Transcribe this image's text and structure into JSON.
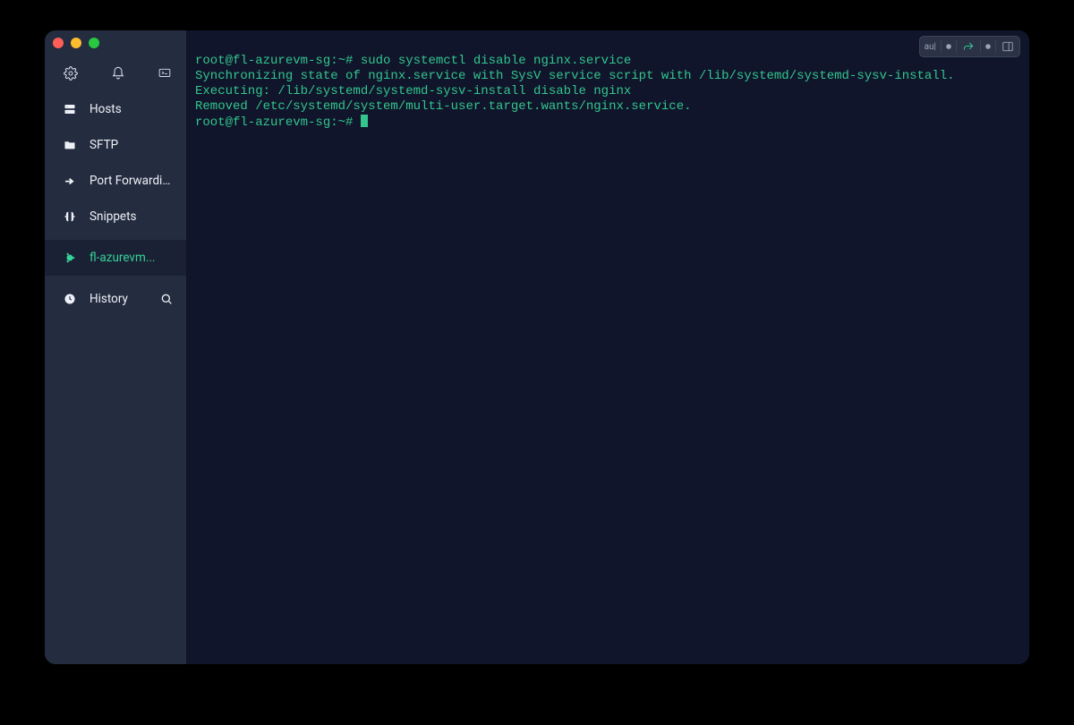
{
  "sidebar": {
    "nav": [
      {
        "id": "hosts",
        "label": "Hosts"
      },
      {
        "id": "sftp",
        "label": "SFTP"
      },
      {
        "id": "port-forwarding",
        "label": "Port Forwarding"
      },
      {
        "id": "snippets",
        "label": "Snippets"
      },
      {
        "id": "session",
        "label": "fl-azurevm...",
        "active": true
      },
      {
        "id": "history",
        "label": "History"
      }
    ]
  },
  "top_toolbar": {
    "badge": "au|"
  },
  "terminal": {
    "lines": [
      "root@fl-azurevm-sg:~# sudo systemctl disable nginx.service",
      "Synchronizing state of nginx.service with SysV service script with /lib/systemd/systemd-sysv-install.",
      "Executing: /lib/systemd/systemd-sysv-install disable nginx",
      "Removed /etc/systemd/system/multi-user.target.wants/nginx.service.",
      "root@fl-azurevm-sg:~# "
    ]
  }
}
